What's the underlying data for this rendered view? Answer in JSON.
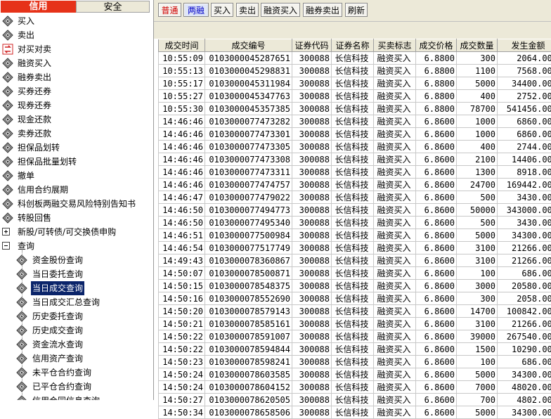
{
  "left_tabs": [
    "信用",
    "安全"
  ],
  "tree": [
    {
      "label": "买入",
      "level": 0,
      "icon": "diamond-icon"
    },
    {
      "label": "卖出",
      "level": 0,
      "icon": "diamond-icon"
    },
    {
      "label": "对买对卖",
      "level": 0,
      "icon": "swap-icon"
    },
    {
      "label": "融资买入",
      "level": 0,
      "icon": "diamond-icon"
    },
    {
      "label": "融券卖出",
      "level": 0,
      "icon": "diamond-icon"
    },
    {
      "label": "买券还券",
      "level": 0,
      "icon": "diamond-icon"
    },
    {
      "label": "现券还券",
      "level": 0,
      "icon": "diamond-icon"
    },
    {
      "label": "现金还款",
      "level": 0,
      "icon": "diamond-icon"
    },
    {
      "label": "卖券还款",
      "level": 0,
      "icon": "diamond-icon"
    },
    {
      "label": "担保品划转",
      "level": 0,
      "icon": "diamond-icon"
    },
    {
      "label": "担保品批量划转",
      "level": 0,
      "icon": "diamond-icon"
    },
    {
      "label": "撤单",
      "level": 0,
      "icon": "diamond-icon"
    },
    {
      "label": "信用合约展期",
      "level": 0,
      "icon": "diamond-icon"
    },
    {
      "label": "科创板两融交易风险特别告知书",
      "level": 0,
      "icon": "diamond-icon"
    },
    {
      "label": "转股回售",
      "level": 0,
      "icon": "diamond-icon"
    },
    {
      "label": "新股/可转债/可交换债申购",
      "level": 0,
      "icon": "expand-plus-icon"
    },
    {
      "label": "查询",
      "level": 0,
      "icon": "collapse-minus-icon"
    },
    {
      "label": "资金股份查询",
      "level": 1,
      "icon": "diamond-icon"
    },
    {
      "label": "当日委托查询",
      "level": 1,
      "icon": "diamond-icon"
    },
    {
      "label": "当日成交查询",
      "level": 1,
      "icon": "diamond-icon",
      "selected": true
    },
    {
      "label": "当日成交汇总查询",
      "level": 1,
      "icon": "diamond-icon"
    },
    {
      "label": "历史委托查询",
      "level": 1,
      "icon": "diamond-icon"
    },
    {
      "label": "历史成交查询",
      "level": 1,
      "icon": "diamond-icon"
    },
    {
      "label": "资金流水查询",
      "level": 1,
      "icon": "diamond-icon"
    },
    {
      "label": "信用资产查询",
      "level": 1,
      "icon": "diamond-icon"
    },
    {
      "label": "未平仓合约查询",
      "level": 1,
      "icon": "diamond-icon"
    },
    {
      "label": "已平仓合约查询",
      "level": 1,
      "icon": "diamond-icon"
    },
    {
      "label": "信用合同信息查询",
      "level": 1,
      "icon": "diamond-icon"
    }
  ],
  "toolbar": [
    {
      "label": "普通",
      "style": "red"
    },
    {
      "label": "两融",
      "style": "blue"
    },
    {
      "label": "买入",
      "style": ""
    },
    {
      "label": "卖出",
      "style": ""
    },
    {
      "label": "融资买入",
      "style": ""
    },
    {
      "label": "融券卖出",
      "style": ""
    },
    {
      "label": "刷新",
      "style": ""
    }
  ],
  "table": {
    "columns": [
      "成交时间",
      "成交编号",
      "证券代码",
      "证券名称",
      "买卖标志",
      "成交价格",
      "成交数量",
      "发生金额"
    ],
    "rows": [
      [
        "10:55:09",
        "0103000045287651",
        "300088",
        "长信科技",
        "融资买入",
        "6.8800",
        "300",
        "2064.000"
      ],
      [
        "10:55:13",
        "0103000045298831",
        "300088",
        "长信科技",
        "融资买入",
        "6.8800",
        "1100",
        "7568.000"
      ],
      [
        "10:55:17",
        "0103000045311984",
        "300088",
        "长信科技",
        "融资买入",
        "6.8800",
        "5000",
        "34400.000"
      ],
      [
        "10:55:27",
        "0103000045347763",
        "300088",
        "长信科技",
        "融资买入",
        "6.8800",
        "400",
        "2752.000"
      ],
      [
        "10:55:30",
        "0103000045357385",
        "300088",
        "长信科技",
        "融资买入",
        "6.8800",
        "78700",
        "541456.000"
      ],
      [
        "14:46:46",
        "0103000077473282",
        "300088",
        "长信科技",
        "融资买入",
        "6.8600",
        "1000",
        "6860.000"
      ],
      [
        "14:46:46",
        "0103000077473301",
        "300088",
        "长信科技",
        "融资买入",
        "6.8600",
        "1000",
        "6860.000"
      ],
      [
        "14:46:46",
        "0103000077473305",
        "300088",
        "长信科技",
        "融资买入",
        "6.8600",
        "400",
        "2744.000"
      ],
      [
        "14:46:46",
        "0103000077473308",
        "300088",
        "长信科技",
        "融资买入",
        "6.8600",
        "2100",
        "14406.000"
      ],
      [
        "14:46:46",
        "0103000077473311",
        "300088",
        "长信科技",
        "融资买入",
        "6.8600",
        "1300",
        "8918.000"
      ],
      [
        "14:46:46",
        "0103000077474757",
        "300088",
        "长信科技",
        "融资买入",
        "6.8600",
        "24700",
        "169442.000"
      ],
      [
        "14:46:47",
        "0103000077479022",
        "300088",
        "长信科技",
        "融资买入",
        "6.8600",
        "500",
        "3430.000"
      ],
      [
        "14:46:50",
        "0103000077494773",
        "300088",
        "长信科技",
        "融资买入",
        "6.8600",
        "50000",
        "343000.000"
      ],
      [
        "14:46:50",
        "0103000077495340",
        "300088",
        "长信科技",
        "融资买入",
        "6.8600",
        "500",
        "3430.000"
      ],
      [
        "14:46:51",
        "0103000077500984",
        "300088",
        "长信科技",
        "融资买入",
        "6.8600",
        "5000",
        "34300.000"
      ],
      [
        "14:46:54",
        "0103000077517749",
        "300088",
        "长信科技",
        "融资买入",
        "6.8600",
        "3100",
        "21266.000"
      ],
      [
        "14:49:43",
        "0103000078360867",
        "300088",
        "长信科技",
        "融资买入",
        "6.8600",
        "3100",
        "21266.000"
      ],
      [
        "14:50:07",
        "0103000078500871",
        "300088",
        "长信科技",
        "融资买入",
        "6.8600",
        "100",
        "686.000"
      ],
      [
        "14:50:15",
        "0103000078548375",
        "300088",
        "长信科技",
        "融资买入",
        "6.8600",
        "3000",
        "20580.000"
      ],
      [
        "14:50:16",
        "0103000078552690",
        "300088",
        "长信科技",
        "融资买入",
        "6.8600",
        "300",
        "2058.000"
      ],
      [
        "14:50:20",
        "0103000078579143",
        "300088",
        "长信科技",
        "融资买入",
        "6.8600",
        "14700",
        "100842.000"
      ],
      [
        "14:50:21",
        "0103000078585161",
        "300088",
        "长信科技",
        "融资买入",
        "6.8600",
        "3100",
        "21266.000"
      ],
      [
        "14:50:22",
        "0103000078591007",
        "300088",
        "长信科技",
        "融资买入",
        "6.8600",
        "39000",
        "267540.000"
      ],
      [
        "14:50:22",
        "0103000078594844",
        "300088",
        "长信科技",
        "融资买入",
        "6.8600",
        "1500",
        "10290.000"
      ],
      [
        "14:50:23",
        "0103000078598241",
        "300088",
        "长信科技",
        "融资买入",
        "6.8600",
        "100",
        "686.000"
      ],
      [
        "14:50:24",
        "0103000078603585",
        "300088",
        "长信科技",
        "融资买入",
        "6.8600",
        "5000",
        "34300.000"
      ],
      [
        "14:50:24",
        "0103000078604152",
        "300088",
        "长信科技",
        "融资买入",
        "6.8600",
        "7000",
        "48020.000"
      ],
      [
        "14:50:27",
        "0103000078620505",
        "300088",
        "长信科技",
        "融资买入",
        "6.8600",
        "700",
        "4802.000"
      ],
      [
        "14:50:34",
        "0103000078658506",
        "300088",
        "长信科技",
        "融资买入",
        "6.8600",
        "5000",
        "34300.000"
      ]
    ]
  }
}
